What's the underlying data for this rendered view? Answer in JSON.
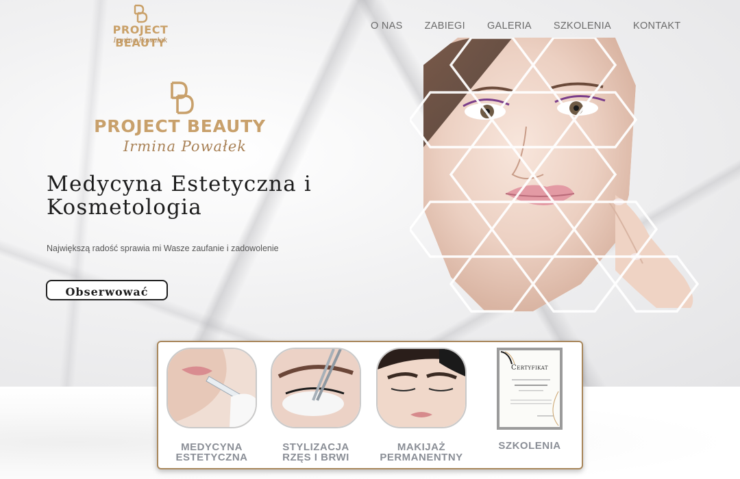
{
  "header": {
    "logo_brand": "PROJECT BEAUTY",
    "logo_script": "Irmina Powałek",
    "nav": [
      "O NAS",
      "ZABIEGI",
      "GALERIA",
      "SZKOLENIA",
      "KONTAKT"
    ]
  },
  "hero": {
    "logo_brand": "PROJECT BEAUTY",
    "logo_script": "Irmina Powałek",
    "headline": "Medycyna Estetyczna i Kosmetologia",
    "tagline": "Największą radość sprawia mi Wasze zaufanie i zadowolenie",
    "cta_label": "Obserwować"
  },
  "services": [
    {
      "label_line1": "MEDYCYNA",
      "label_line2": "ESTETYCZNA"
    },
    {
      "label_line1": "STYLIZACJA",
      "label_line2": "RZĘS I BRWI"
    },
    {
      "label_line1": "MAKIJAŻ",
      "label_line2": "PERMANENTNY"
    },
    {
      "label_line1": "SZKOLENIA",
      "label_line2": ""
    }
  ],
  "certificate": {
    "title": "Certyfikat"
  },
  "colors": {
    "gold": "#c8a06b",
    "text_dark": "#1c1c1c",
    "nav_gray": "#6a6a6a",
    "service_gray": "#8a8e96",
    "panel_border": "#a8865a"
  }
}
